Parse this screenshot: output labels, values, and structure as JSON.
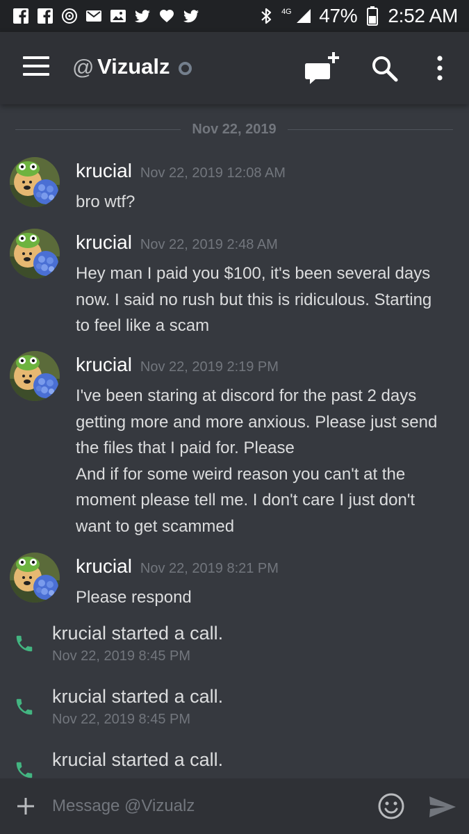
{
  "status_bar": {
    "network": "4G",
    "battery": "47%",
    "time": "2:52 AM",
    "notification_icons": [
      "facebook-icon",
      "facebook-icon",
      "music-icon",
      "mail-icon",
      "gallery-icon",
      "twitter-icon",
      "heart-icon",
      "twitter-icon"
    ]
  },
  "header": {
    "at_symbol": "@",
    "title": "Vizualz",
    "status": "offline"
  },
  "date_divider": "Nov 22, 2019",
  "messages": [
    {
      "author": "krucial",
      "timestamp": "Nov 22, 2019 12:08 AM",
      "lines": [
        "bro wtf?"
      ]
    },
    {
      "author": "krucial",
      "timestamp": "Nov 22, 2019 2:48 AM",
      "lines": [
        "Hey man I paid you $100, it's been several days",
        "now. I said no rush but this is ridiculous. Starting",
        "to feel like a scam"
      ]
    },
    {
      "author": "krucial",
      "timestamp": "Nov 22, 2019 2:19 PM",
      "lines": [
        "I've been staring at discord for the past 2 days",
        "getting more and more anxious. Please just send",
        "the files that I paid for. Please",
        "And if for some weird reason you can't at the",
        "moment please tell me. I don't care I just don't",
        "want to get scammed"
      ]
    },
    {
      "author": "krucial",
      "timestamp": "Nov 22, 2019 8:21 PM",
      "lines": [
        "Please respond"
      ]
    }
  ],
  "calls": [
    {
      "text": "krucial started a call.",
      "time": "Nov 22, 2019 8:45 PM"
    },
    {
      "text": "krucial started a call.",
      "time": "Nov 22, 2019 8:45 PM"
    },
    {
      "text": "krucial started a call.",
      "time": ""
    }
  ],
  "composer": {
    "placeholder": "Message @Vizualz"
  },
  "colors": {
    "background": "#36393f",
    "header_bg": "#2f3136",
    "status_bar_bg": "#202225",
    "call_green": "#43b581",
    "muted_text": "#72767d"
  }
}
